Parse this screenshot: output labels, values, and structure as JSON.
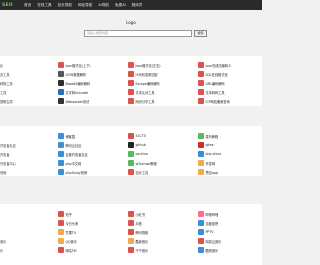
{
  "header": {
    "brand": "SEO",
    "nav": [
      "首页",
      "在线工具",
      "站长导航",
      "网址导航",
      "AI导航",
      "免费AI",
      "程序员"
    ]
  },
  "search": {
    "logo_text": "Logo",
    "placeholder": "请输入搜索内容",
    "button": "搜索"
  },
  "sections": [
    {
      "rows": [
        {
          "lead": "比",
          "items": [
            {
              "label": "Json格式化(上下)",
              "color": "#d9534f"
            },
            {
              "label": "Json格式化(左右)",
              "color": "#d9534f"
            },
            {
              "label": "Json在线压缩转义",
              "color": "#d9534f"
            }
          ]
        },
        {
          "lead": "办工具",
          "items": [
            {
              "label": "JSON数据解析",
              "color": "#555"
            },
            {
              "label": "JS代码混淆加密",
              "color": "#d9534f"
            },
            {
              "label": "SQL在线格式化",
              "color": "#d9534f"
            }
          ]
        },
        {
          "lead": "转换工具",
          "items": [
            {
              "label": "Base64编码解码",
              "color": "#2e2e2e"
            },
            {
              "label": "Escape编码解码",
              "color": "#d9534f"
            },
            {
              "label": "URL编码解码",
              "color": "#d9534f"
            }
          ]
        },
        {
          "lead": "工具",
          "items": [
            {
              "label": "文字转Unicode",
              "color": "#2a6ebb"
            },
            {
              "label": "文本比对工具",
              "color": "#d9534f"
            },
            {
              "label": "文本转码工具",
              "color": "#d9534f"
            }
          ]
        },
        {
          "lead": "提取生成",
          "items": [
            {
              "label": "Websocket测试",
              "color": "#333"
            },
            {
              "label": "网页分享工具",
              "color": "#d9534f"
            },
            {
              "label": "ICP网站备案查询",
              "color": "#d9534f"
            }
          ]
        }
      ]
    },
    {
      "rows": [
        {
          "lead": "",
          "items": [
            {
              "label": "博客园",
              "color": "#3b8fd8"
            },
            {
              "label": "51CTO",
              "color": "#d9534f"
            },
            {
              "label": "菜鸟教程",
              "color": "#5cb85c"
            }
          ]
        },
        {
          "lead": "开发者社区",
          "items": [
            {
              "label": "腾讯云社区",
              "color": "#3b8fd8"
            },
            {
              "label": "github",
              "color": "#222"
            },
            {
              "label": "gitee",
              "color": "#c9302c"
            }
          ]
        },
        {
          "lead": "开发者",
          "items": [
            {
              "label": "百度开发者社区",
              "color": "#3b8fd8"
            },
            {
              "label": "oschina",
              "color": "#5cb85c"
            },
            {
              "label": "php.china",
              "color": "#3b8fd8"
            }
          ]
        },
        {
          "lead": "开发者中心",
          "items": [
            {
              "label": "php中文网",
              "color": "#3b8fd8"
            },
            {
              "label": "w3school教程",
              "color": "#5cb85c"
            },
            {
              "label": "开发网",
              "color": "#f0ad4e"
            }
          ]
        },
        {
          "lead": "官网",
          "items": [
            {
              "label": "phpStudy官网",
              "color": "#3b8fd8"
            },
            {
              "label": "站长工具",
              "color": "#d9534f"
            },
            {
              "label": "思否app",
              "color": "#f0ad4e"
            }
          ]
        }
      ]
    },
    {
      "rows": [
        {
          "lead": "",
          "items": [
            {
              "label": "知乎",
              "color": "#d9534f"
            },
            {
              "label": "小红书",
              "color": "#d9534f"
            },
            {
              "label": "哔哩哔哩",
              "color": "#ff6b9a"
            }
          ]
        },
        {
          "lead": "",
          "items": [
            {
              "label": "今日头条",
              "color": "#d9534f"
            },
            {
              "label": "抖音",
              "color": "#d9534f"
            },
            {
              "label": "百度贴吧",
              "color": "#3b8fd8"
            }
          ]
        },
        {
          "lead": "",
          "items": [
            {
              "label": "芒果TV",
              "color": "#f0ad4e"
            },
            {
              "label": "腾讯视频",
              "color": "#d9534f"
            },
            {
              "label": "PPTV",
              "color": "#3b8fd8"
            }
          ]
        },
        {
          "lead": "音乐",
          "items": [
            {
              "label": "QQ音乐",
              "color": "#f0ad4e"
            },
            {
              "label": "酷我音乐",
              "color": "#f0ad4e"
            },
            {
              "label": "网易云音乐",
              "color": "#d9534f"
            }
          ]
        },
        {
          "lead": "乐",
          "items": [
            {
              "label": "咪咕FM",
              "color": "#d9534f"
            },
            {
              "label": "千千音乐",
              "color": "#d9534f"
            },
            {
              "label": "酷狗音乐",
              "color": "#3b8fd8"
            }
          ]
        }
      ]
    }
  ]
}
